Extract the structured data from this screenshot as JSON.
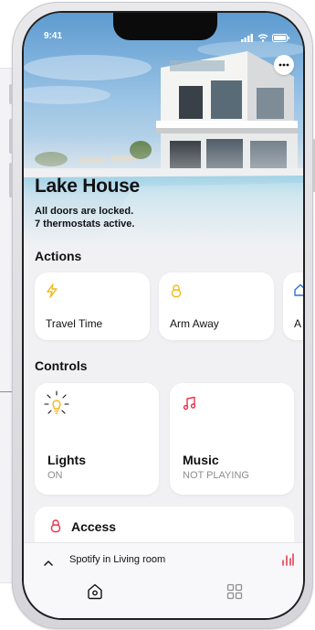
{
  "status_bar": {
    "time": "9:41"
  },
  "home": {
    "title": "Lake House",
    "status_line1": "All doors are locked.",
    "status_line2": "7 thermostats active."
  },
  "actions": {
    "title": "Actions",
    "items": [
      {
        "label": "Travel Time",
        "icon": "lightning-icon"
      },
      {
        "label": "Arm Away",
        "icon": "lock-icon"
      },
      {
        "label": "A",
        "icon": "house-icon"
      }
    ]
  },
  "controls": {
    "title": "Controls",
    "items": [
      {
        "name": "Lights",
        "state": "ON",
        "icon": "lightbulb-icon"
      },
      {
        "name": "Music",
        "state": "NOT PLAYING",
        "icon": "music-note-icon"
      }
    ]
  },
  "access": {
    "label": "Access",
    "icon": "lock-icon"
  },
  "now_playing": {
    "text": "Spotify in Living room"
  },
  "tabs": [
    {
      "name": "home",
      "icon": "home-icon"
    },
    {
      "name": "grid",
      "icon": "grid-icon"
    }
  ],
  "colors": {
    "accent_yellow": "#F2B81C",
    "accent_red": "#E5334B",
    "accent_blue": "#2F6FD6",
    "text_primary": "#111114",
    "text_secondary": "#8D8D92",
    "background": "#F1F1F3"
  }
}
